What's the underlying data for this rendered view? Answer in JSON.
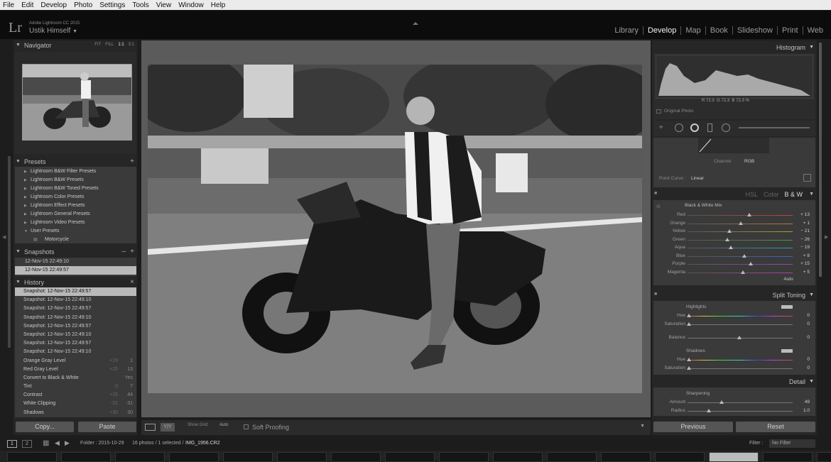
{
  "menu": [
    "File",
    "Edit",
    "Develop",
    "Photo",
    "Settings",
    "Tools",
    "View",
    "Window",
    "Help"
  ],
  "identity": {
    "logo": "Lr",
    "app_name": "Adobe Lightroom CC 2015",
    "user": "Ustik Himself"
  },
  "modules": [
    {
      "label": "Library",
      "active": false
    },
    {
      "label": "Develop",
      "active": true
    },
    {
      "label": "Map",
      "active": false
    },
    {
      "label": "Book",
      "active": false
    },
    {
      "label": "Slideshow",
      "active": false
    },
    {
      "label": "Print",
      "active": false
    },
    {
      "label": "Web",
      "active": false
    }
  ],
  "navigator": {
    "title": "Navigator",
    "zoom_options": [
      "FIT",
      "FILL",
      "1:1",
      "3:1"
    ]
  },
  "presets": {
    "title": "Presets",
    "items": [
      "Lightroom B&W Filter Presets",
      "Lightroom B&W Presets",
      "Lightroom B&W Toned Presets",
      "Lightroom Color Presets",
      "Lightroom Effect Presets",
      "Lightroom General Presets",
      "Lightroom Video Presets",
      "User Presets"
    ],
    "sub_item": "Motorcycle"
  },
  "snapshots": {
    "title": "Snapshots",
    "items": [
      "12-Nov-15 22:49:10",
      "12-Nov-15 22:49:57"
    ]
  },
  "history": {
    "title": "History",
    "items": [
      {
        "label": "Snapshot: 12-Nov-15 22:49:57",
        "v1": "",
        "v2": ""
      },
      {
        "label": "Snapshot: 12-Nov-15 22:49:10",
        "v1": "",
        "v2": ""
      },
      {
        "label": "Snapshot: 12-Nov-15 22:49:57",
        "v1": "",
        "v2": ""
      },
      {
        "label": "Snapshot: 12-Nov-15 22:49:10",
        "v1": "",
        "v2": ""
      },
      {
        "label": "Snapshot: 12-Nov-15 22:49:57",
        "v1": "",
        "v2": ""
      },
      {
        "label": "Snapshot: 12-Nov-15 22:49:10",
        "v1": "",
        "v2": ""
      },
      {
        "label": "Snapshot: 12-Nov-15 22:49:57",
        "v1": "",
        "v2": ""
      },
      {
        "label": "Snapshot: 12-Nov-15 22:49:10",
        "v1": "",
        "v2": ""
      },
      {
        "label": "Orange Gray Level",
        "v1": "+19",
        "v2": "1"
      },
      {
        "label": "Red Gray Level",
        "v1": "+25",
        "v2": "13"
      },
      {
        "label": "Convert to Black & White",
        "v1": "",
        "v2": "Yes"
      },
      {
        "label": "Tint",
        "v1": "0",
        "v2": "7"
      },
      {
        "label": "Contrast",
        "v1": "+25",
        "v2": "44"
      },
      {
        "label": "White Clipping",
        "v1": "-31",
        "v2": "-31"
      },
      {
        "label": "Shadows",
        "v1": "+30",
        "v2": "30"
      }
    ]
  },
  "left_buttons": {
    "copy": "Copy...",
    "paste": "Paste"
  },
  "toolbar": {
    "show_grid": "Show Grid:",
    "grid_mode": "Auto",
    "soft_proofing": "Soft Proofing"
  },
  "histogram": {
    "title": "Histogram",
    "r_label": "R",
    "r": "72.3",
    "g_label": "G",
    "g": "72.3",
    "b_label": "B",
    "b": "72.3",
    "pct": "%",
    "original": "Original Photo"
  },
  "tone_curve": {
    "channel_label": "Channel",
    "channel": "RGB",
    "point_curve_label": "Point Curve :",
    "point_curve": "Linear"
  },
  "hsl": {
    "tabs": [
      "HSL",
      "Color",
      "B & W"
    ],
    "active": "B & W",
    "mix_title": "Black & White Mix",
    "auto": "Auto",
    "rows": [
      {
        "label": "Red",
        "value": "+ 13",
        "pos": 0.59,
        "color": "#c04040"
      },
      {
        "label": "Orange",
        "value": "+ 1",
        "pos": 0.51,
        "color": "#c07a30"
      },
      {
        "label": "Yellow",
        "value": "− 21",
        "pos": 0.4,
        "color": "#b0a030"
      },
      {
        "label": "Green",
        "value": "− 26",
        "pos": 0.38,
        "color": "#40a040"
      },
      {
        "label": "Aqua",
        "value": "− 19",
        "pos": 0.41,
        "color": "#30a0a0"
      },
      {
        "label": "Blue",
        "value": "+ 8",
        "pos": 0.54,
        "color": "#4060c0"
      },
      {
        "label": "Purple",
        "value": "+ 15",
        "pos": 0.6,
        "color": "#8050b0"
      },
      {
        "label": "Magenta",
        "value": "+ 5",
        "pos": 0.53,
        "color": "#b040a0"
      }
    ]
  },
  "split_toning": {
    "title": "Split Toning",
    "highlights": "Highlights",
    "shadows": "Shadows",
    "hue_label": "Hue",
    "sat_label": "Saturation",
    "balance_label": "Balance",
    "h_hue": "0",
    "h_sat": "0",
    "balance": "0",
    "s_hue": "0",
    "s_sat": "0"
  },
  "detail": {
    "title": "Detail",
    "sharpening": "Sharpening",
    "amount_label": "Amount",
    "amount": "49",
    "radius_label": "Radius",
    "radius": "1.0"
  },
  "right_buttons": {
    "previous": "Previous",
    "reset": "Reset"
  },
  "filmstrip": {
    "folder": "Folder : 2015-10-29",
    "count": "16 photos / 1 selected /",
    "file": "IMG_1956.CR2",
    "filter_label": "Filter :",
    "filter": "No Filter",
    "page1": "1",
    "page2": "2"
  }
}
